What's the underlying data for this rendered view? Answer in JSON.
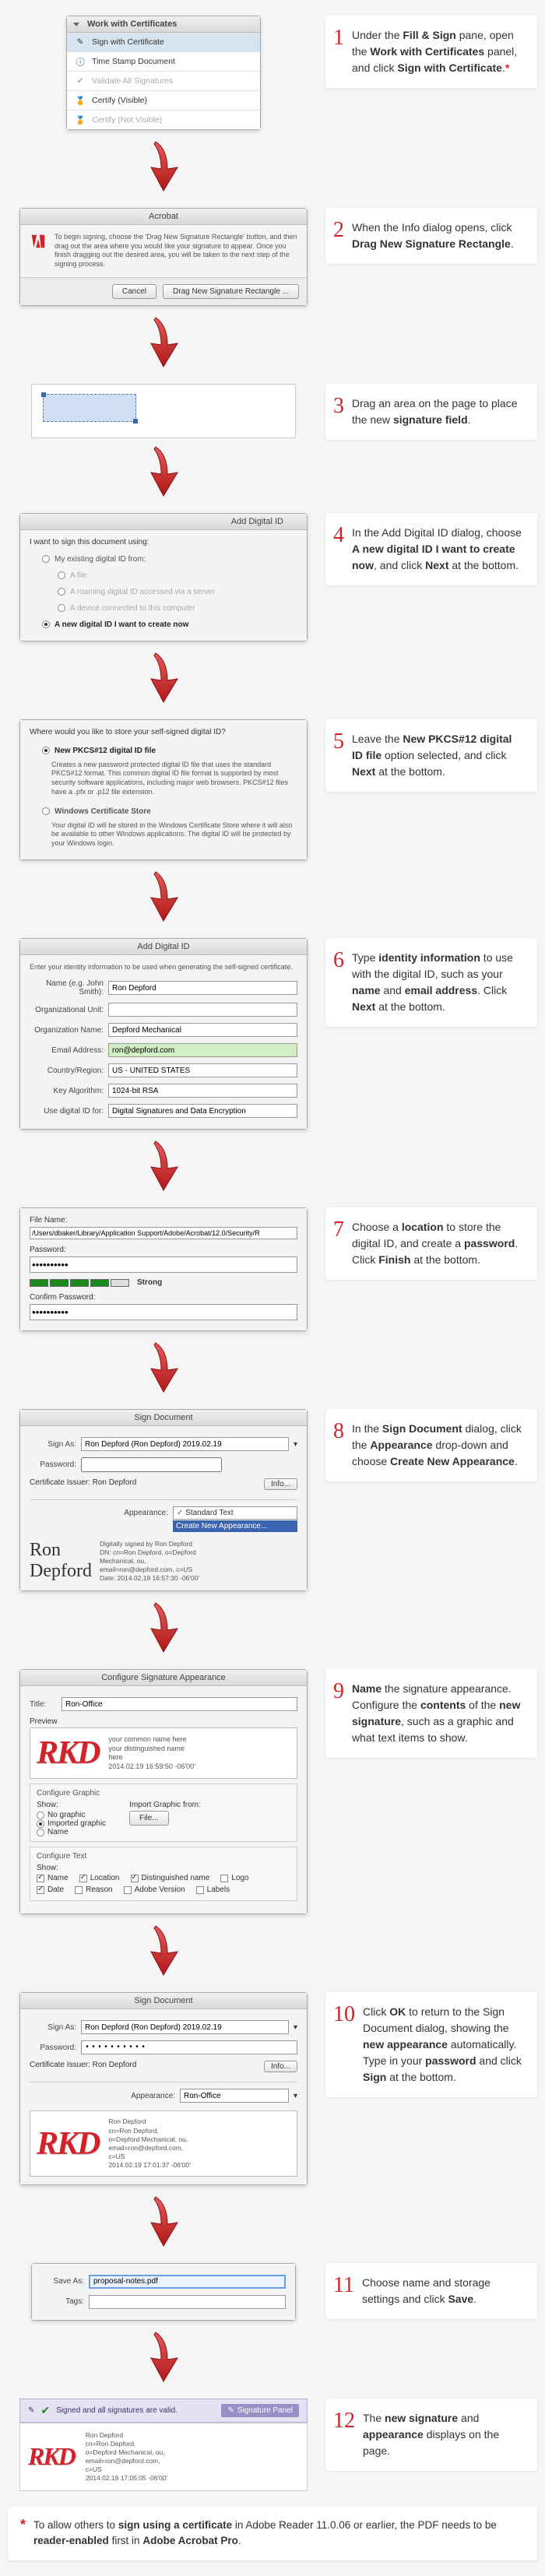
{
  "steps": {
    "s1": {
      "num": "1",
      "text": "Under the <b>Fill & Sign</b> pane, open the <b>Work with Certificates</b> panel, and click <b>Sign with Certificate</b>.<span class='star'>*</span>"
    },
    "s2": {
      "num": "2",
      "text": "When the Info dialog opens, click <b>Drag New Signature Rectangle</b>."
    },
    "s3": {
      "num": "3",
      "text": "Drag an area on the page to place the new <b>signature field</b>."
    },
    "s4": {
      "num": "4",
      "text": "In the Add Digital ID dialog, choose <b>A new digital ID I want to create now</b>, and click <b>Next</b> at the bottom."
    },
    "s5": {
      "num": "5",
      "text": "Leave the <b>New PKCS#12 digital ID file</b> option selected, and click <b>Next</b> at the bottom."
    },
    "s6": {
      "num": "6",
      "text": "Type <b>identity information</b> to use with the digital ID, such as your <b>name</b> and <b>email address</b>. Click <b>Next</b> at the bottom."
    },
    "s7": {
      "num": "7",
      "text": "Choose a <b>location</b> to store the digital ID, and create a <b>password</b>. Click <b>Finish</b> at the bottom."
    },
    "s8": {
      "num": "8",
      "text": "In the <b>Sign Document</b> dialog, click the <b>Appearance</b> drop-down and choose <b>Create New Appearance</b>."
    },
    "s9": {
      "num": "9",
      "text": "<b>Name</b> the signature appearance. Configure the <b>contents</b> of the <b>new signature</b>, such as a graphic and what text items to show."
    },
    "s10": {
      "num": "10",
      "text": "Click <b>OK</b> to return to the Sign Document dialog, showing the <b>new appearance</b> automatically. Type in your <b>password</b> and click <b>Sign</b> at the bottom."
    },
    "s11": {
      "num": "11",
      "text": "Choose name and storage settings and click <b>Save</b>."
    },
    "s12": {
      "num": "12",
      "text": "The <b>new signature</b> and <b>appearance</b> displays on the page."
    }
  },
  "panel1": {
    "header": "Work with Certificates",
    "items": [
      "Sign with Certificate",
      "Time Stamp Document",
      "Validate All Signatures",
      "Certify (Visible)",
      "Certify (Not Visible)"
    ]
  },
  "dialog2": {
    "title": "Acrobat",
    "body": "To begin signing, choose the 'Drag New Signature Rectangle' button, and then drag out the area where you would like your signature to appear. Once you finish dragging out the desired area, you will be taken to the next step of the signing process.",
    "cancel": "Cancel",
    "drag": "Drag New Signature Rectangle ..."
  },
  "dialog4": {
    "title": "Add Digital ID",
    "prompt": "I want to sign this document using:",
    "opts": [
      "My existing digital ID from:",
      "A file",
      "A roaming digital ID accessed via a server",
      "A device connected to this computer",
      "A new digital ID I want to create now"
    ]
  },
  "dialog5": {
    "prompt": "Where would you like to store your self-signed digital ID?",
    "opt1": "New PKCS#12 digital ID file",
    "desc1": "Creates a new password protected digital ID file that uses the standard PKCS#12 format. This common digital ID file format is supported by most security software applications, including major web browsers. PKCS#12 files have a .pfx or .p12 file extension.",
    "opt2": "Windows Certificate Store",
    "desc2": "Your digital ID will be stored in the Windows Certificate Store where it will also be available to other Windows applications. The digital ID will be protected by your Windows login."
  },
  "dialog6": {
    "title": "Add Digital ID",
    "prompt": "Enter your identity information to be used when generating the self-signed certificate.",
    "fields": {
      "name_lbl": "Name (e.g. John Smith):",
      "name_val": "Ron Depford",
      "unit_lbl": "Organizational Unit:",
      "unit_val": "",
      "org_lbl": "Organization Name:",
      "org_val": "Depford Mechanical",
      "email_lbl": "Email Address:",
      "email_val": "ron@depford.com",
      "country_lbl": "Country/Region:",
      "country_val": "US - UNITED STATES",
      "key_lbl": "Key Algorithm:",
      "key_val": "1024-bit RSA",
      "use_lbl": "Use digital ID for:",
      "use_val": "Digital Signatures and Data Encryption"
    }
  },
  "dialog7": {
    "file_lbl": "File Name:",
    "file_val": "/Users/dbaker/Library/Application Support/Adobe/Acrobat/12.0/Security/R",
    "pw_lbl": "Password:",
    "strength": "Strong",
    "confirm_lbl": "Confirm Password:"
  },
  "dialog8": {
    "title": "Sign Document",
    "signas_lbl": "Sign As:",
    "signas_val": "Ron Depford (Ron Depford) 2019.02.19",
    "pw_lbl": "Password:",
    "issuer_lbl": "Certificate Issuer: Ron Depford",
    "info": "Info...",
    "appear_lbl": "Appearance:",
    "appear_val": "Standard Text",
    "create": "Create New Appearance...",
    "sig_name": "Ron\nDepford",
    "sig_detail": "Digitally signed by Ron Depford\nDN: cn=Ron Depford, o=Depford\nMechanical, ou,\nemail=ron@depford.com, c=US\nDate: 2014.02.19 16:57:30 -06'00'"
  },
  "dialog9": {
    "title": "Configure Signature Appearance",
    "title_lbl": "Title:",
    "title_val": "Ron-Office",
    "preview": "Preview",
    "common": "your common name here\nyour distinguished name\nhere\n2014.02.19 16:59:50 -06'00'",
    "graphic_title": "Configure Graphic",
    "show_lbl": "Show:",
    "g1": "No graphic",
    "g2": "Imported graphic",
    "g3": "Name",
    "import_lbl": "Import Graphic from:",
    "file_btn": "File...",
    "text_title": "Configure Text",
    "t_name": "Name",
    "t_loc": "Location",
    "t_dn": "Distinguished name",
    "t_logo": "Logo",
    "t_date": "Date",
    "t_reason": "Reason",
    "t_ver": "Adobe Version",
    "t_labels": "Labels"
  },
  "dialog10": {
    "title": "Sign Document",
    "signas_lbl": "Sign As:",
    "signas_val": "Ron Depford (Ron Depford) 2019.02.19",
    "pw_lbl": "Password:",
    "pw_val": "••••••••••",
    "issuer": "Certificate Issuer: Ron Depford",
    "info": "Info...",
    "appear_lbl": "Appearance:",
    "appear_val": "Ron-Office",
    "detail": "Ron Depford\ncn=Ron Depford,\no=Depford Mechanical, ou,\nemail=ron@depford.com,\nc=US\n2014.02.19 17:01:37 -06'00'"
  },
  "dialog11": {
    "save_lbl": "Save As:",
    "save_val": "proposal-notes.pdf",
    "tags_lbl": "Tags:"
  },
  "dialog12": {
    "valid": "Signed and all signatures are valid.",
    "panel_btn": "Signature Panel",
    "detail": "Ron Depford\ncn=Ron Depford,\no=Depford Mechanical, ou,\nemail=ron@depford.com,\nc=US\n2014.02.19 17:05:05 -06'00'"
  },
  "footnote": "To allow others to <b>sign using a certificate</b> in Adobe Reader 11.0.06 or earlier, the PDF needs to be <b>reader-enabled</b> first in <b>Adobe Acrobat Pro</b>."
}
